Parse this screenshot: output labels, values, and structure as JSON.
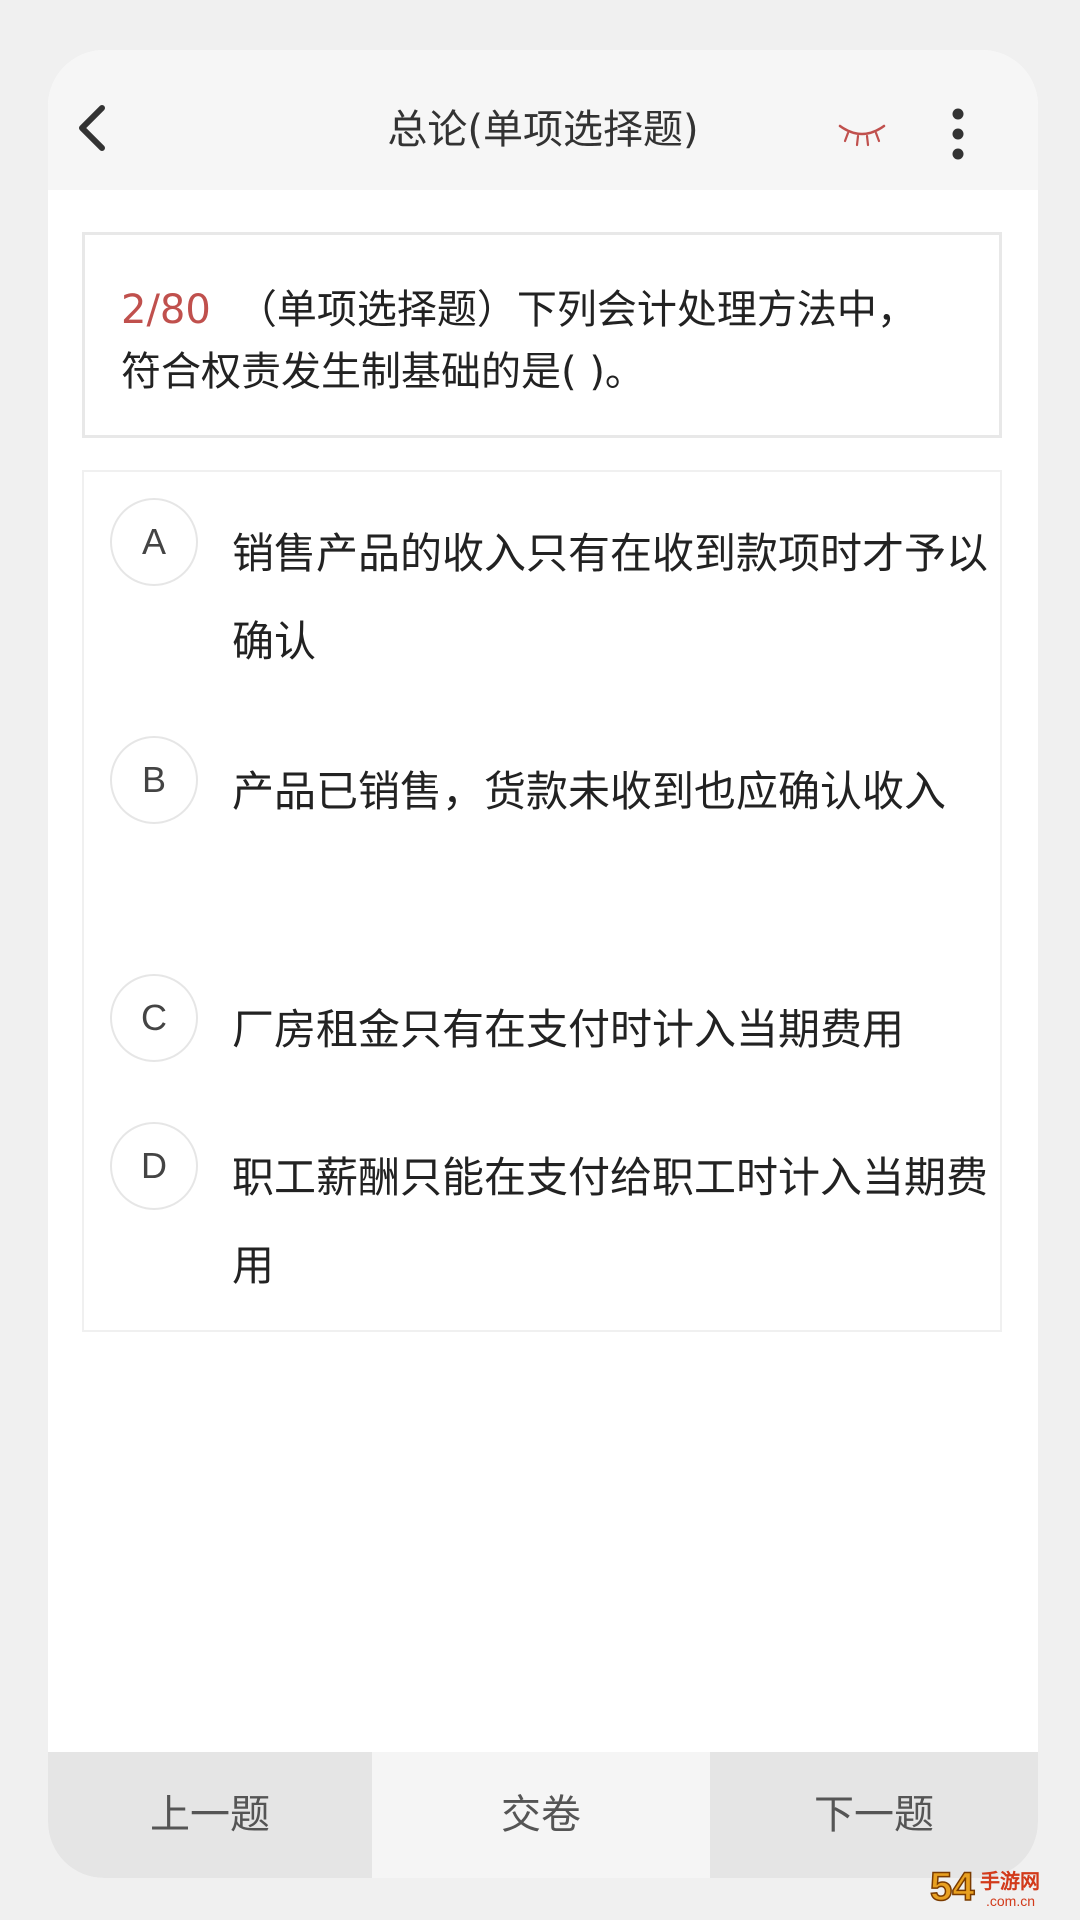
{
  "header": {
    "title": "总论(单项选择题)",
    "back_icon": "chevron-left-icon",
    "eye_icon": "eye-closed-icon",
    "more_icon": "more-vertical-icon"
  },
  "question": {
    "number": "2/80",
    "text": "（单项选择题）下列会计处理方法中，符合权责发生制基础的是( )。"
  },
  "options": [
    {
      "letter": "A",
      "text": "销售产品的收入只有在收到款项时才予以确认"
    },
    {
      "letter": "B",
      "text": "产品已销售，货款未收到也应确认收入"
    },
    {
      "letter": "C",
      "text": "厂房租金只有在支付时计入当期费用"
    },
    {
      "letter": "D",
      "text": "职工薪酬只能在支付给职工时计入当期费用"
    }
  ],
  "footer": {
    "prev_label": "上一题",
    "submit_label": "交卷",
    "next_label": "下一题"
  },
  "watermark": {
    "text": "54手游网",
    "domain": ".com.cn"
  },
  "colors": {
    "accent": "#c0504d",
    "eye": "#c0504d",
    "watermark": "#e8a020"
  }
}
